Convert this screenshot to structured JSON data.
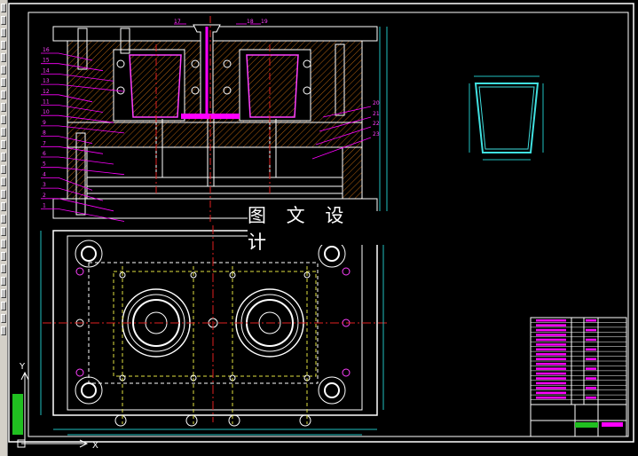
{
  "app": {
    "name": "CAD drawing view",
    "colors": {
      "background": "#000000",
      "frame": "#ffffff",
      "geometry": "#e8e8e8",
      "hatch": "#b06010",
      "centerline": "#e02020",
      "leader": "#ff00ff",
      "product": "#40e0e0",
      "dimension": "#20c0c0",
      "title_block": "#ff00ff",
      "stamp": "#20c020"
    }
  },
  "watermark": {
    "text": "图 文 设 计"
  },
  "left_toolbar": {
    "button_count": 27
  },
  "ucs": {
    "x_label": "X",
    "y_label": "Y"
  },
  "part_callouts_left": [
    "16",
    "15",
    "14",
    "13",
    "12",
    "11",
    "10",
    "9",
    "8",
    "7",
    "6",
    "5",
    "4",
    "3",
    "2",
    "1"
  ],
  "part_callouts_top": [
    "17",
    "18",
    "19"
  ],
  "part_callouts_right": [
    "20",
    "21",
    "22",
    "23"
  ],
  "title_block": {
    "rows": 18
  }
}
